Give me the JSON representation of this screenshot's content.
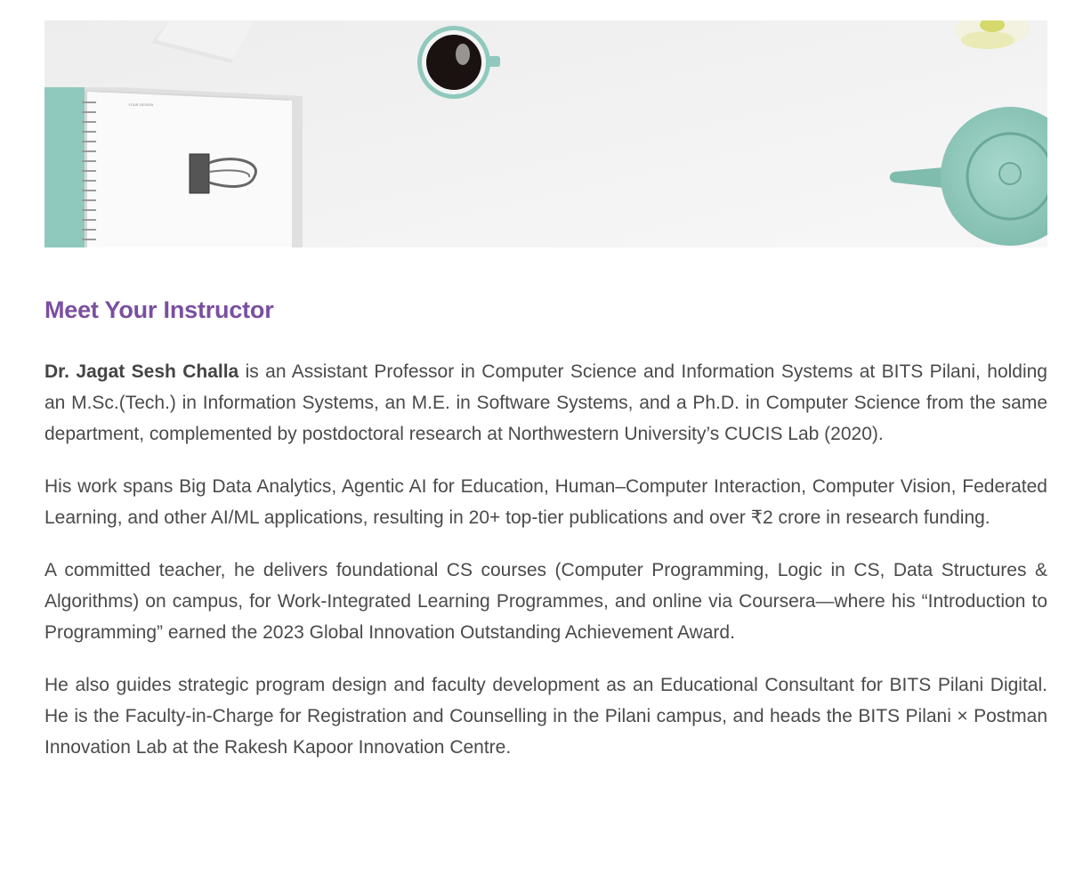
{
  "section": {
    "heading": "Meet Your Instructor"
  },
  "banner": {
    "image": "desk-flatlay-notebook-coffee-teapot",
    "notebook_label": "YOUR DESIGN"
  },
  "bio": {
    "p1_name": "Dr. Jagat Sesh Challa",
    "p1_rest": " is an Assistant Professor in Computer Science and Information Systems at BITS Pilani, holding an M.Sc.(Tech.) in Information Systems, an M.E. in Software Systems, and a Ph.D. in Computer Science from the same department, complemented by postdoctoral research at Northwestern University’s CUCIS Lab (2020).",
    "p2": "His work spans Big Data Analytics, Agentic AI for Education, Human–Computer Interaction, Computer Vision, Federated Learning, and other AI/ML applications, resulting in 20+ top-tier publications and over ₹2 crore in research funding.",
    "p3": "A committed teacher, he delivers foundational CS courses (Computer Programming, Logic in CS, Data Structures & Algorithms) on campus, for Work-Integrated Learning Programmes, and online via Coursera—where his “Introduction to Programming” earned the 2023 Global Innovation Outstanding Achievement Award.",
    "p4": "He also guides strategic program design and faculty development as an Educational Consultant for BITS Pilani Digital. He is the Faculty-in-Charge for Registration and Counselling in the Pilani campus, and heads the BITS Pilani × Postman Innovation Lab at the Rakesh Kapoor Innovation Centre."
  },
  "colors": {
    "heading": "#7b4fa0",
    "body_text": "#4a4a4a",
    "mint": "#8fc9bd"
  }
}
